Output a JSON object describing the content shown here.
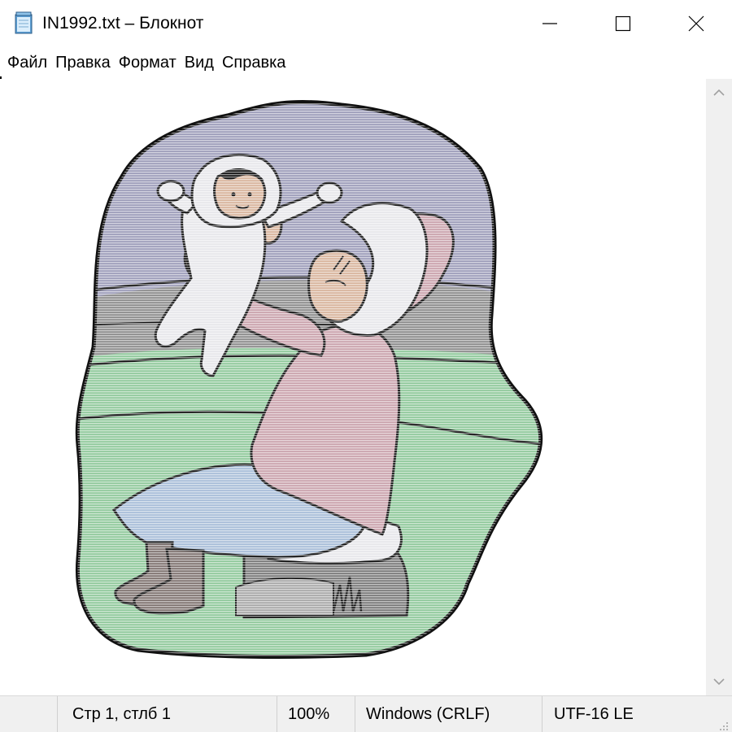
{
  "window": {
    "title": "IN1992.txt – Блокнот",
    "app_icon": "notepad-icon",
    "controls": {
      "minimize_icon": "minimize-icon",
      "maximize_icon": "maximize-icon",
      "close_icon": "close-icon"
    }
  },
  "menu": {
    "items": [
      "Файл",
      "Правка",
      "Формат",
      "Вид",
      "Справка"
    ]
  },
  "editor": {
    "content": "ascii-art-illustration"
  },
  "scrollbar": {
    "up_icon": "chevron-up-icon",
    "down_icon": "chevron-down-icon"
  },
  "status": {
    "position": "Стр 1, стлб 1",
    "zoom": "100%",
    "line_endings": "Windows (CRLF)",
    "encoding": "UTF-16 LE"
  },
  "colors": {
    "window_bg": "#ffffff",
    "chrome_bg": "#f0f0f0",
    "art_sky": "#9b9bb8",
    "art_hill": "#8a8a8a",
    "art_grass": "#8ec89a",
    "art_coat": "#c9a1ab",
    "art_skirt": "#a6bcd8",
    "art_fur": "#e6e6ea",
    "art_skin": "#d8b39b",
    "art_boots": "#7d716e"
  }
}
